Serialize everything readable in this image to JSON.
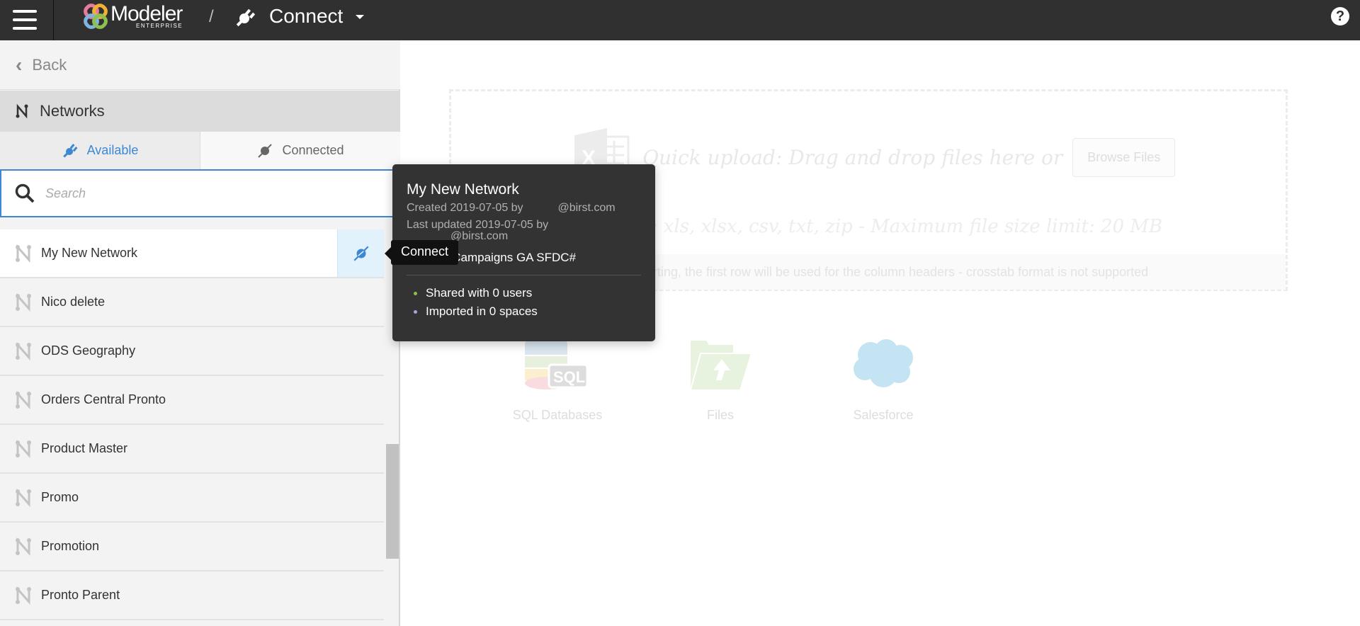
{
  "topbar": {
    "brand_name": "Modeler",
    "brand_sub": "ENTERPRISE",
    "separator": "/",
    "section_title": "Connect",
    "help_label": "?"
  },
  "sidebar": {
    "back_label": "Back",
    "section_label": "Networks",
    "tabs": [
      {
        "label": "Available",
        "active": true
      },
      {
        "label": "Connected",
        "active": false
      }
    ],
    "search": {
      "placeholder": "Search",
      "value": ""
    },
    "items": [
      {
        "label": "My New Network",
        "selected": true
      },
      {
        "label": "Nico delete"
      },
      {
        "label": "ODS Geography"
      },
      {
        "label": "Orders Central Pronto"
      },
      {
        "label": "Product Master"
      },
      {
        "label": "Promo"
      },
      {
        "label": "Promotion"
      },
      {
        "label": "Pronto Parent"
      }
    ]
  },
  "main": {
    "quick_upload": "Quick upload: Drag and drop files here or",
    "browse_label": "Browse Files",
    "formats": "Formats: xls, xlsx, csv, txt, zip - Maximum file size limit: 20 MB",
    "hint": "When importing, the first row will be used for the column headers - crosstab format is not supported",
    "sources": [
      {
        "label": "SQL Databases",
        "icon": "sql-database-icon"
      },
      {
        "label": "Files",
        "icon": "folder-upload-icon"
      },
      {
        "label": "Salesforce",
        "icon": "salesforce-cloud-icon"
      }
    ]
  },
  "popover": {
    "title": "My New Network",
    "created": "Created 2019-07-05 by           @birst.com",
    "updated_line1": "Last updated 2019-07-05 by",
    "updated_line2": "@birst.com",
    "origin": "Origin: #Campaigns GA SFDC#",
    "stats": [
      {
        "label": "Shared with 0 users",
        "color": "#8bc34a"
      },
      {
        "label": "Imported in 0 spaces",
        "color": "#b39ddb"
      }
    ]
  },
  "tooltip": {
    "label": "Connect"
  },
  "colors": {
    "accent": "#3d87d3",
    "topbar": "#303030",
    "popover": "#333333"
  }
}
